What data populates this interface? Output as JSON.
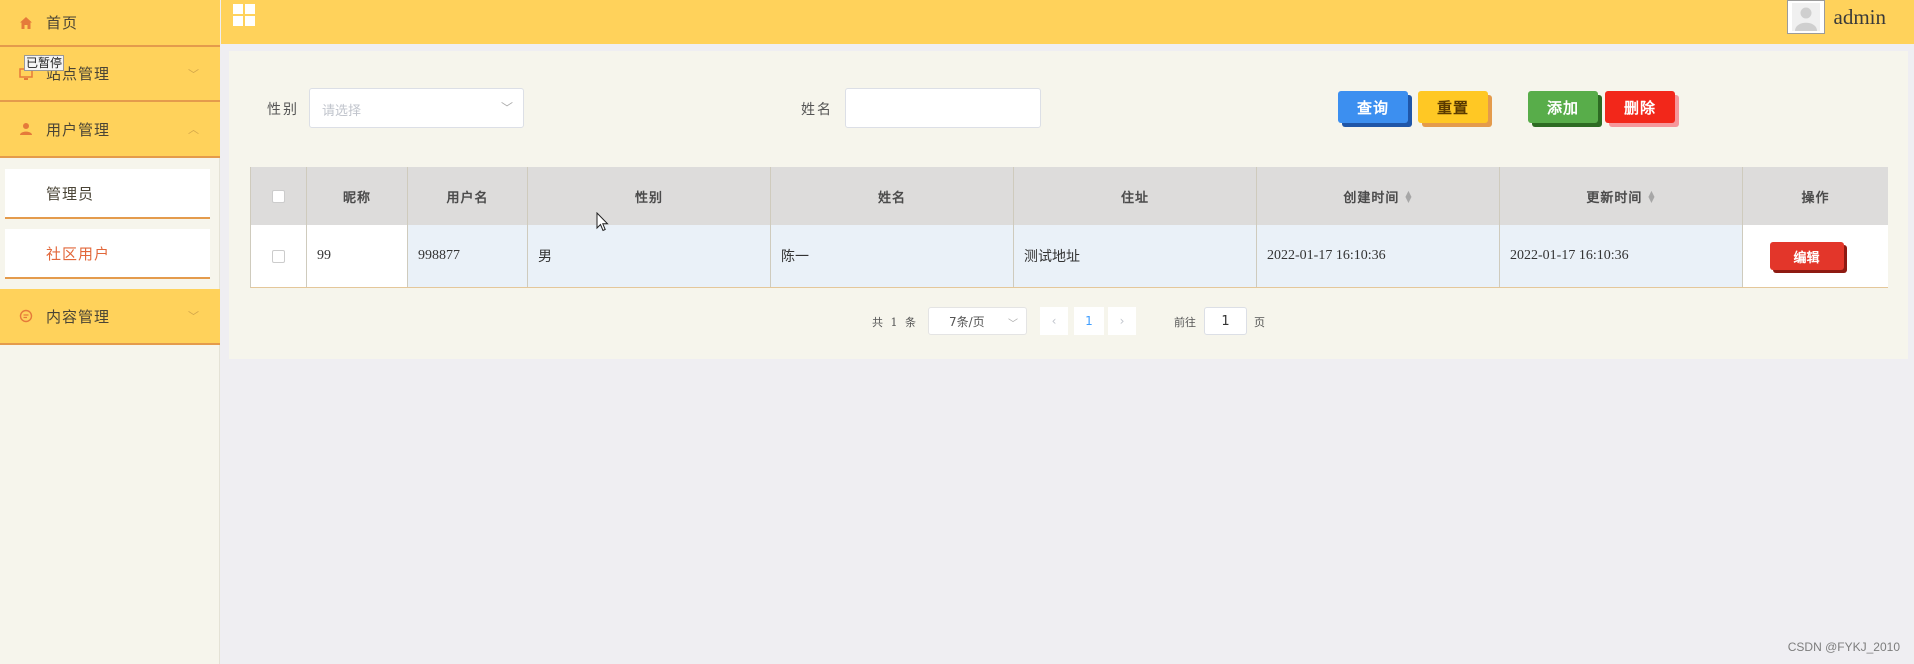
{
  "sidebar": {
    "items": [
      {
        "label": "首页",
        "icon": "home-icon"
      },
      {
        "label": "站点管理",
        "icon": "monitor-icon"
      },
      {
        "label": "用户管理",
        "icon": "user-icon"
      },
      {
        "label": "内容管理",
        "icon": "chat-icon"
      }
    ],
    "subitems": [
      {
        "label": "管理员"
      },
      {
        "label": "社区用户"
      }
    ],
    "overlay_tag": "已暂停"
  },
  "header": {
    "username": "admin"
  },
  "search": {
    "gender_label": "性别",
    "gender_placeholder": "请选择",
    "name_label": "姓名",
    "name_value": ""
  },
  "toolbar": {
    "query": "查询",
    "reset": "重置",
    "add": "添加",
    "delete": "删除"
  },
  "table": {
    "columns": [
      "昵称",
      "用户名",
      "性别",
      "姓名",
      "住址",
      "创建时间",
      "更新时间",
      "操作"
    ],
    "rows": [
      {
        "nickname": "99",
        "username": "998877",
        "gender": "男",
        "name": "陈一",
        "address": "测试地址",
        "created": "2022-01-17 16:10:36",
        "updated": "2022-01-17 16:10:36",
        "edit": "编辑"
      }
    ]
  },
  "pagination": {
    "total": "共 1 条",
    "page_size": "7条/页",
    "current": "1",
    "goto_label": "前往",
    "goto_value": "1",
    "page_suffix": "页"
  },
  "watermark": "CSDN @FYKJ_2010",
  "colors": {
    "header": "#ffd25b",
    "query": "#3c8ff0",
    "reset": "#ffc824",
    "add": "#58ad4a",
    "delete": "#f2271a",
    "edit": "#e3362a",
    "active_subitem": "#e2673a"
  }
}
